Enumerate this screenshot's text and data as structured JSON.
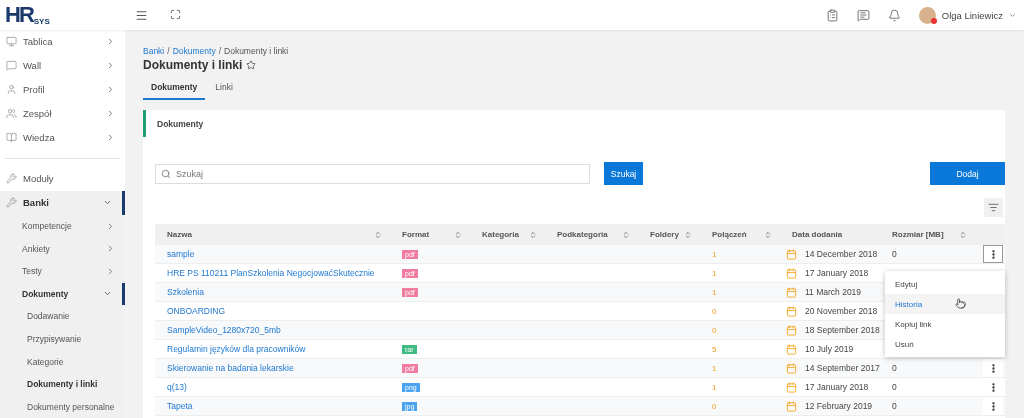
{
  "header": {
    "logo_main": "HR",
    "logo_sub": "SYS",
    "user_name": "Olga Liniewicz"
  },
  "sidebar": {
    "items": [
      {
        "label": "Tablica",
        "selected": false,
        "expanded": false
      },
      {
        "label": "Wall",
        "selected": false,
        "expanded": false
      },
      {
        "label": "Profil",
        "selected": false,
        "expanded": false
      },
      {
        "label": "Zespół",
        "selected": false,
        "expanded": false
      },
      {
        "label": "Wiedza",
        "selected": false,
        "expanded": false
      },
      {
        "label": "Moduły",
        "selected": false
      },
      {
        "label": "Banki",
        "selected": true,
        "expanded": true,
        "children": [
          {
            "label": "Kompetencje",
            "selected": false,
            "expanded": false
          },
          {
            "label": "Ankiety",
            "selected": false,
            "expanded": false
          },
          {
            "label": "Testy",
            "selected": false,
            "expanded": false
          },
          {
            "label": "Dokumenty",
            "selected": true,
            "expanded": true,
            "children": [
              {
                "label": "Dodawanie",
                "selected": false
              },
              {
                "label": "Przypisywanie",
                "selected": false
              },
              {
                "label": "Kategorie",
                "selected": false
              },
              {
                "label": "Dokumenty i linki",
                "selected": true
              },
              {
                "label": "Dokumenty personalne",
                "selected": false
              }
            ]
          }
        ]
      }
    ]
  },
  "breadcrumb": [
    {
      "label": "Banki",
      "link": true
    },
    {
      "separator_before": "/",
      "label": "Dokumenty",
      "link": true
    },
    {
      "separator_before": "/",
      "label": "Dokumenty i linki",
      "link": false
    }
  ],
  "page_title": "Dokumenty i linki",
  "tabs": [
    {
      "label": "Dokumenty",
      "selected": true
    },
    {
      "label": "Linki",
      "selected": false
    }
  ],
  "card_title": "Dokumenty",
  "search": {
    "placeholder": "Szukaj",
    "button": "Szukaj"
  },
  "add_button": "Dodaj",
  "table": {
    "columns": [
      {
        "label": "Nazwa",
        "sortable": true
      },
      {
        "label": "Format",
        "sortable": true
      },
      {
        "label": "Kategoria",
        "sortable": true
      },
      {
        "label": "Podkategoria",
        "sortable": true
      },
      {
        "label": "Foldery",
        "sortable": true
      },
      {
        "label": "Połączeń",
        "sortable": true
      },
      {
        "label": "Data dodania",
        "sortable": false
      },
      {
        "label": "Rozmiar [MB]",
        "sortable": true
      }
    ],
    "rows": [
      {
        "name": "sample",
        "format": {
          "label": "pdf",
          "color": "#f07ca0"
        },
        "connections": "1",
        "date": "14 December 2018",
        "size": "0",
        "menu_open": true
      },
      {
        "name": "HRE PS 110211 PlanSzkolenia NegocjowaćSkutecznie",
        "format": {
          "label": "pdf",
          "color": "#f07ca0"
        },
        "connections": "1",
        "date": "17 January 2018"
      },
      {
        "name": "Szkolenia",
        "format": {
          "label": "pdf",
          "color": "#f07ca0"
        },
        "connections": "1",
        "date": "11 March 2019"
      },
      {
        "name": "ONBOARDING",
        "connections": "0",
        "date": "20 November 2018"
      },
      {
        "name": "SampleVideo_1280x720_5mb",
        "connections": "0",
        "date": "18 September 2018"
      },
      {
        "name": "Regulamin języków dla pracowników",
        "format": {
          "label": "rar",
          "color": "#3dbb82"
        },
        "connections": "5",
        "date": "10 July 2019"
      },
      {
        "name": "Skierowanie na badania lekarskie",
        "format": {
          "label": "pdf",
          "color": "#f07ca0"
        },
        "connections": "1",
        "date": "14 September 2017",
        "size": "0",
        "menu_open": false
      },
      {
        "name": "q(13)",
        "format": {
          "label": "png",
          "color": "#4aa3f0"
        },
        "connections": "1",
        "date": "17 January 2018",
        "size": "0",
        "menu_open": false
      },
      {
        "name": "Tapeta",
        "format": {
          "label": "jpg",
          "color": "#4aa3f0"
        },
        "connections": "0",
        "date": "12 February 2019",
        "size": "0",
        "menu_open": false
      }
    ]
  },
  "row_menu": {
    "items": [
      {
        "label": "Edytuj",
        "selected": false
      },
      {
        "label": "Historia",
        "selected": true
      },
      {
        "label": "Kopiuj link",
        "selected": false
      },
      {
        "label": "Usuń",
        "selected": false
      }
    ]
  }
}
